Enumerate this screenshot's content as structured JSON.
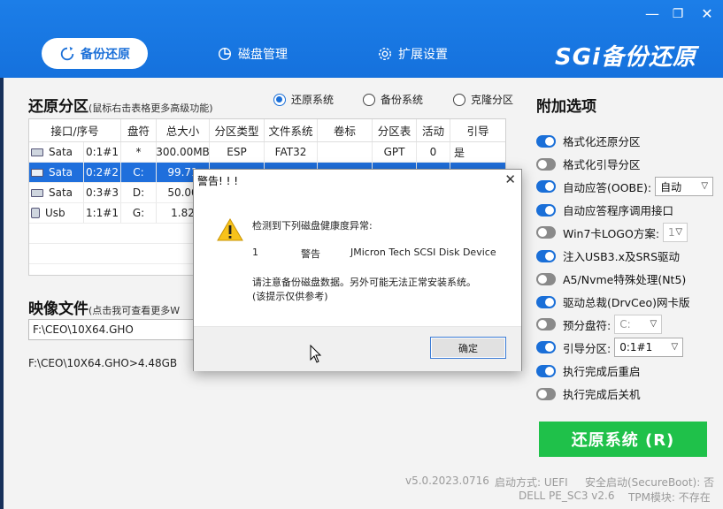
{
  "header": {
    "tabs": [
      {
        "label": "备份还原",
        "active": true
      },
      {
        "label": "磁盘管理",
        "active": false
      },
      {
        "label": "扩展设置",
        "active": false
      }
    ],
    "brand": "SGi备份还原",
    "controls": {
      "minimize": "—",
      "close": "✕"
    }
  },
  "restore_partition": {
    "title": "还原分区",
    "subtitle": "(鼠标右击表格更多高级功能)",
    "modes": [
      {
        "label": "还原系统",
        "selected": true
      },
      {
        "label": "备份系统",
        "selected": false
      },
      {
        "label": "克隆分区",
        "selected": false
      }
    ],
    "columns": [
      "接口/序号",
      "盘符",
      "总大小",
      "分区类型",
      "文件系统",
      "卷标",
      "分区表",
      "活动",
      "引导"
    ],
    "rows": [
      {
        "iface": "Sata",
        "num": "0:1#1",
        "drive": "*",
        "size": "300.00MB",
        "ptype": "ESP",
        "fs": "FAT32",
        "label": "",
        "table": "GPT",
        "active": "0",
        "boot": "是"
      },
      {
        "iface": "Sata",
        "num": "0:2#2",
        "drive": "C:",
        "size": "99.71",
        "ptype": "",
        "fs": "",
        "label": "",
        "table": "",
        "active": "",
        "boot": ""
      },
      {
        "iface": "Sata",
        "num": "0:3#3",
        "drive": "D:",
        "size": "50.00",
        "ptype": "",
        "fs": "",
        "label": "",
        "table": "",
        "active": "",
        "boot": ""
      },
      {
        "iface": "Usb",
        "num": "1:1#1",
        "drive": "G:",
        "size": "1.82",
        "ptype": "",
        "fs": "",
        "label": "",
        "table": "",
        "active": "",
        "boot": ""
      }
    ]
  },
  "image_file": {
    "title": "映像文件",
    "subtitle": "(点击我可查看更多W",
    "path": "F:\\CEO\\10X64.GHO",
    "info": "F:\\CEO\\10X64.GHO>4.48GB"
  },
  "options": {
    "title": "附加选项",
    "items": [
      {
        "label": "格式化还原分区",
        "on": true
      },
      {
        "label": "格式化引导分区",
        "on": false
      },
      {
        "label": "自动应答(OOBE):",
        "on": true,
        "select": "自动"
      },
      {
        "label": "自动应答程序调用接口",
        "on": true
      },
      {
        "label": "Win7卡LOGO方案:",
        "on": false,
        "select": "1",
        "disabled": true
      },
      {
        "label": "注入USB3.x及SRS驱动",
        "on": true
      },
      {
        "label": "A5/Nvme特殊处理(Nt5)",
        "on": false
      },
      {
        "label": "驱动总裁(DrvCeo)网卡版",
        "on": true
      },
      {
        "label": "预分盘符:",
        "on": false,
        "select": "C:",
        "disabled": true
      },
      {
        "label": "引导分区:",
        "on": true,
        "select": "0:1#1"
      },
      {
        "label": "执行完成后重启",
        "on": true
      },
      {
        "label": "执行完成后关机",
        "on": false
      }
    ],
    "restore_button": "还原系统 (R)"
  },
  "footer": {
    "version": "v5.0.2023.0716",
    "boot_mode": "启动方式: UEFI",
    "secure_boot": "安全启动(SecureBoot): 否",
    "model": "DELL  PE_SC3  v2.6",
    "tpm": "TPM模块: 不存在"
  },
  "dialog": {
    "title": "警告! ! !",
    "line1": "检测到下列磁盘健康度异常:",
    "row_num": "1",
    "row_level": "警告",
    "row_device": "JMicron Tech SCSI Disk Device",
    "line3": "请注意备份磁盘数据。另外可能无法正常安装系统。",
    "line4": "(该提示仅供参考)",
    "ok": "确定"
  }
}
